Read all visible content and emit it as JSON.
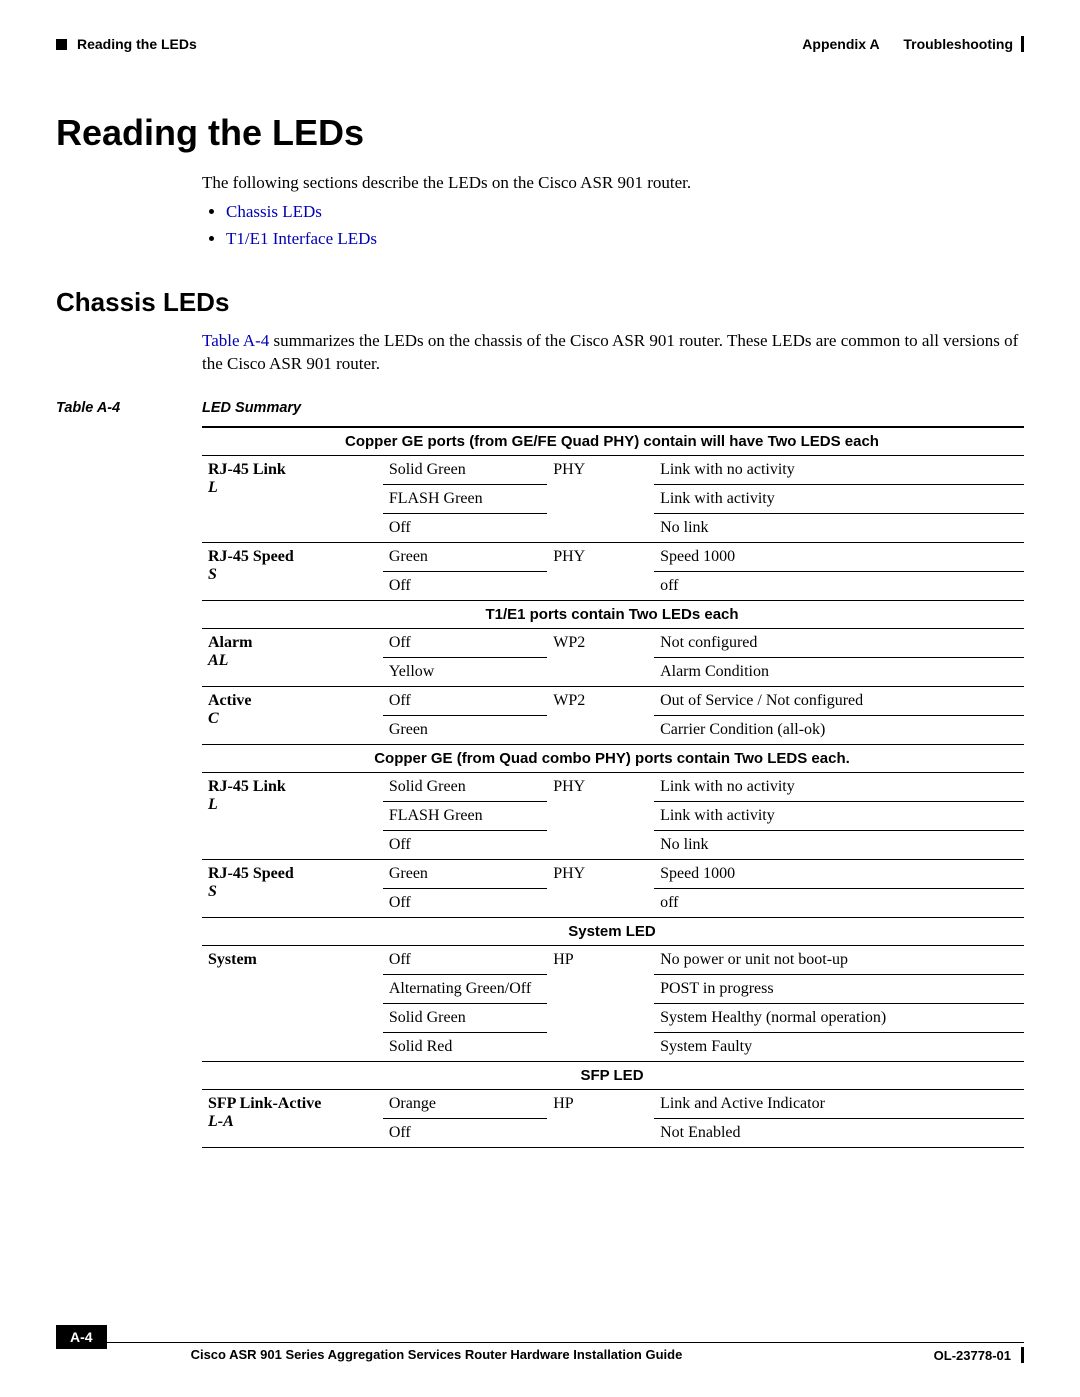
{
  "header": {
    "left_label": "Reading the LEDs",
    "right_appendix": "Appendix A",
    "right_title": "Troubleshooting"
  },
  "h1": "Reading the LEDs",
  "intro": {
    "text": "The following sections describe the LEDs on the Cisco ASR 901 router.",
    "links": [
      "Chassis LEDs",
      "T1/E1 Interface LEDs"
    ]
  },
  "h2": "Chassis LEDs",
  "chassis_para_pre": "Table A-4",
  "chassis_para_post": " summarizes the LEDs on the chassis of the Cisco ASR 901 router. These LEDs are common to all versions of the Cisco ASR 901 router.",
  "table_caption_id": "Table A-4",
  "table_caption_title": "LED Summary",
  "table": {
    "groups": [
      {
        "heading": "Copper GE ports (from GE/FE Quad PHY) contain will have Two LEDS each",
        "rows": [
          {
            "name": "RJ-45 Link",
            "abbr": "L",
            "c2": "Solid Green",
            "c3": "PHY",
            "c4": "Link with no activity",
            "span3": 3
          },
          {
            "c2": "FLASH Green",
            "c4": "Link with activity"
          },
          {
            "c2": "Off",
            "c4": "No link"
          },
          {
            "name": "RJ-45 Speed",
            "abbr": "S",
            "c2": "Green",
            "c3": "PHY",
            "c4": "Speed 1000",
            "span3": 2
          },
          {
            "c2": "Off",
            "c4": "off"
          }
        ]
      },
      {
        "heading": "T1/E1 ports contain Two LEDs each",
        "rows": [
          {
            "name": "Alarm",
            "abbr": "AL",
            "c2": "Off",
            "c3": "WP2",
            "c4": "Not configured",
            "span3": 2
          },
          {
            "c2": "Yellow",
            "c4": "Alarm Condition"
          },
          {
            "name": "Active",
            "abbr": "C",
            "c2": "Off",
            "c3": "WP2",
            "c4": "Out of Service / Not configured",
            "span3": 2
          },
          {
            "c2": "Green",
            "c4": "Carrier Condition (all-ok)"
          }
        ]
      },
      {
        "heading": "Copper GE (from Quad combo PHY) ports contain Two LEDS each.",
        "rows": [
          {
            "name": "RJ-45 Link",
            "abbr": "L",
            "c2": "Solid Green",
            "c3": "PHY",
            "c4": "Link with no activity",
            "span3": 3
          },
          {
            "c2": "FLASH Green",
            "c4": "Link with activity"
          },
          {
            "c2": "Off",
            "c4": "No link"
          },
          {
            "name": "RJ-45 Speed",
            "abbr": "S",
            "c2": "Green",
            "c3": "PHY",
            "c4": "Speed 1000",
            "span3": 2
          },
          {
            "c2": "Off",
            "c4": "off"
          }
        ]
      },
      {
        "heading": "System LED",
        "rows": [
          {
            "name": "System",
            "abbr": "",
            "c2": "Off",
            "c3": "HP",
            "c4": "No power or unit not boot-up",
            "span3": 4,
            "span1": 4
          },
          {
            "c2": "Alternating Green/Off",
            "c4": "POST in progress"
          },
          {
            "c2": "Solid Green",
            "c4": "System Healthy (normal operation)"
          },
          {
            "c2": "Solid Red",
            "c4": "System Faulty"
          }
        ]
      },
      {
        "heading": "SFP LED",
        "rows": [
          {
            "name": "SFP Link-Active",
            "abbr": "L-A",
            "c2": "Orange",
            "c3": "HP",
            "c4": "Link and Active Indicator",
            "span3": 2
          },
          {
            "c2": "Off",
            "c4": "Not Enabled"
          }
        ]
      }
    ]
  },
  "footer": {
    "guide": "Cisco ASR 901 Series Aggregation Services Router Hardware Installation Guide",
    "page": "A-4",
    "doc": "OL-23778-01"
  }
}
